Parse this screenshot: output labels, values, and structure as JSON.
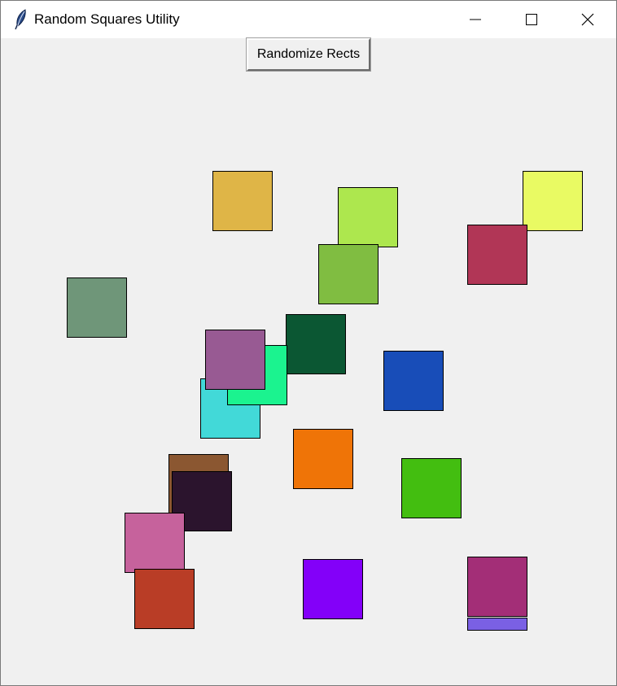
{
  "window": {
    "title": "Random Squares Utility",
    "app_icon": "feather-icon",
    "controls": {
      "minimize_icon": "minimize-icon",
      "maximize_icon": "maximize-icon",
      "close_icon": "close-icon"
    }
  },
  "toolbar": {
    "randomize_label": "Randomize Rects"
  },
  "canvas": {
    "background": "#f0f0f0",
    "square_colors": [
      "#dfb547",
      "#e9fa63",
      "#b13656",
      "#ade74e",
      "#80bd41",
      "#6f9679",
      "#0b5733",
      "#42d9d8",
      "#1bf38f",
      "#985a93",
      "#184db8",
      "#8b5731",
      "#2b142d",
      "#c6629c",
      "#ef7407",
      "#43be10",
      "#b93d26",
      "#8300f9",
      "#7a60e4",
      "#a32e77"
    ]
  }
}
